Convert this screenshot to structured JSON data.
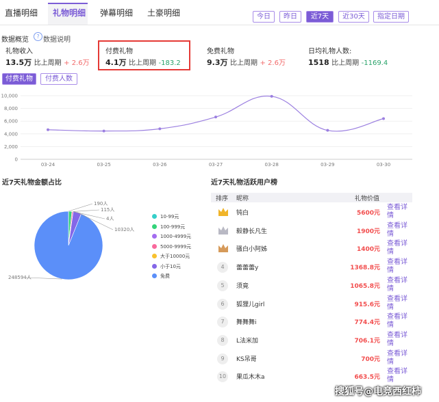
{
  "tabs": [
    "直播明细",
    "礼物明细",
    "弹幕明细",
    "土豪明细"
  ],
  "date_ranges": [
    "今日",
    "昨日",
    "近7天",
    "近30天",
    "指定日期"
  ],
  "active_range": "近7天",
  "overview": {
    "title": "数据概览",
    "help": "数据说明"
  },
  "stats": [
    {
      "label": "礼物收入",
      "value": "13.5万",
      "cmp_label": "比上周期",
      "change": "+ 2.6万"
    },
    {
      "label": "付费礼物",
      "value": "4.1万",
      "cmp_label": "比上周期",
      "change": "-183.2"
    },
    {
      "label": "免费礼物",
      "value": "9.3万",
      "cmp_label": "比上周期",
      "change": "+ 2.6万"
    },
    {
      "label": "日均礼物人数:",
      "value": "1518",
      "cmp_label": "比上周期",
      "change": "-1169.4"
    }
  ],
  "toggles": [
    "付费礼物",
    "付费人数"
  ],
  "colors": {
    "accent": "#7b5cd6",
    "line": "#9b7fe0",
    "up": "#f26b6b",
    "down": "#29a36a",
    "highlight_box": "#e53935"
  },
  "chart_data": [
    {
      "type": "line",
      "x": [
        "03-24",
        "03-25",
        "03-26",
        "03-27",
        "03-28",
        "03-29",
        "03-30"
      ],
      "y_ticks": [
        "0",
        "2,000",
        "4,000",
        "6,000",
        "8,000",
        "10,000"
      ],
      "ylim": [
        0,
        10000
      ],
      "series": [
        {
          "values": [
            4650,
            4450,
            4800,
            6650,
            9900,
            4550,
            6400
          ]
        }
      ],
      "grid": true
    },
    {
      "type": "pie",
      "title": "近7天礼物金额占比",
      "slices": [
        {
          "label": "10-99元",
          "value": 190,
          "display": "190人",
          "color": "#36cfc9"
        },
        {
          "label": "100-999元",
          "value": 4000,
          "display": "",
          "color": "#34d37a"
        },
        {
          "label": "1000-4999元",
          "value": 4,
          "display": "4人",
          "color": "#a36cf0"
        },
        {
          "label": "5000-9999元",
          "value": 1500,
          "display": "",
          "color": "#f9699c"
        },
        {
          "label": "大于10000元",
          "value": 115,
          "display": "115人",
          "color": "#f8c12f"
        },
        {
          "label": "小于10元",
          "value": 10320,
          "display": "10320人",
          "color": "#8467e8"
        },
        {
          "label": "免费",
          "value": 248594,
          "display": "248594人",
          "color": "#5b8ff9"
        }
      ]
    }
  ],
  "ranking": {
    "title": "近7天礼物活跃用户榜",
    "headers": {
      "rank": "排序",
      "nick": "昵称",
      "value": "礼物价值"
    },
    "detail_label": "查看详情",
    "rows": [
      {
        "rank": "1",
        "nick": "钝白",
        "value": "5600元"
      },
      {
        "rank": "2",
        "nick": "毅静长凡生",
        "value": "1900元"
      },
      {
        "rank": "3",
        "nick": "骚白小阿姊",
        "value": "1400元"
      },
      {
        "rank": "4",
        "nick": "蕾蕾蕾y",
        "value": "1368.8元"
      },
      {
        "rank": "5",
        "nick": "须竟",
        "value": "1065.8元"
      },
      {
        "rank": "6",
        "nick": "狐狸儿girl",
        "value": "915.6元"
      },
      {
        "rank": "7",
        "nick": "舞舞舞i",
        "value": "774.4元"
      },
      {
        "rank": "8",
        "nick": "L法米加",
        "value": "706.1元"
      },
      {
        "rank": "9",
        "nick": "KS吊哥",
        "value": "700元"
      },
      {
        "rank": "10",
        "nick": "果瓜木木a",
        "value": "663.5元"
      }
    ]
  },
  "watermark": "搜狐号@电竞西红柿"
}
